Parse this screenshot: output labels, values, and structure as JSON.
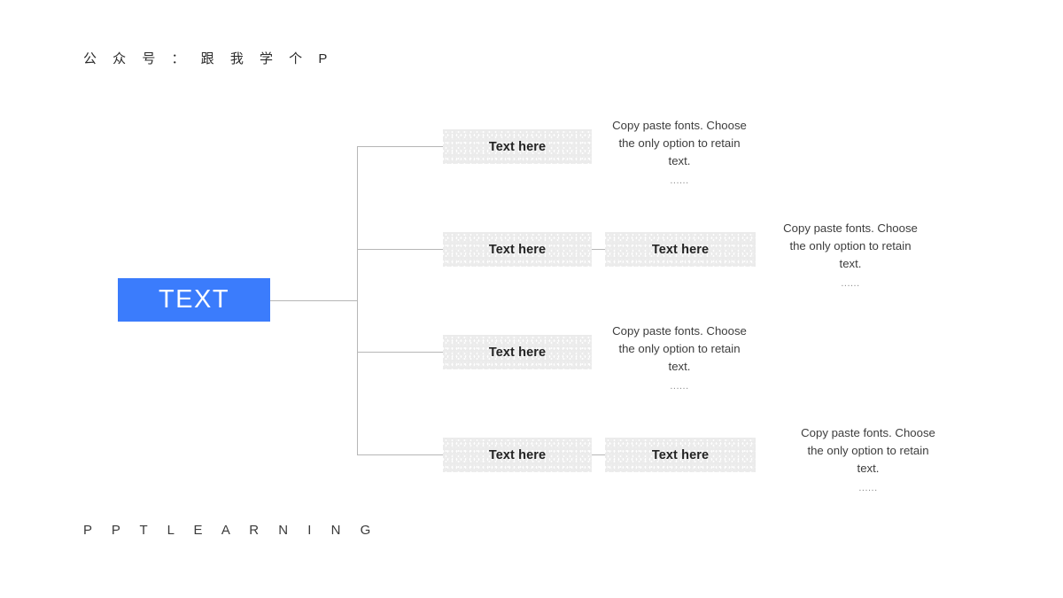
{
  "slide": {
    "header": "公 众 号 ： 跟 我 学 个 P",
    "footer": "P P T   L E A R N I N G",
    "background_color": "#ffffff"
  },
  "colors": {
    "accent_blue": "#3b7cfc",
    "node_gray": "#ebebeb",
    "line_gray": "#b6b6b6",
    "text_dark": "#232323",
    "text_body": "#3d3d3d",
    "dots_gray": "#8d8d8d"
  },
  "diagram": {
    "root": {
      "label": "TEXT"
    },
    "branches": [
      {
        "level1": "Text here",
        "level2": null,
        "paragraph": "Copy paste fonts. Choose the only option to retain text.",
        "paragraph_dots": "......"
      },
      {
        "level1": "Text here",
        "level2": "Text here",
        "paragraph": "Copy paste fonts. Choose the only option to retain text.",
        "paragraph_dots": "......"
      },
      {
        "level1": "Text here",
        "level2": null,
        "paragraph": "Copy paste fonts. Choose the only option to retain text.",
        "paragraph_dots": "......"
      },
      {
        "level1": "Text here",
        "level2": "Text here",
        "paragraph": "Copy paste fonts. Choose the only option to retain text.",
        "paragraph_dots": "......"
      }
    ]
  }
}
